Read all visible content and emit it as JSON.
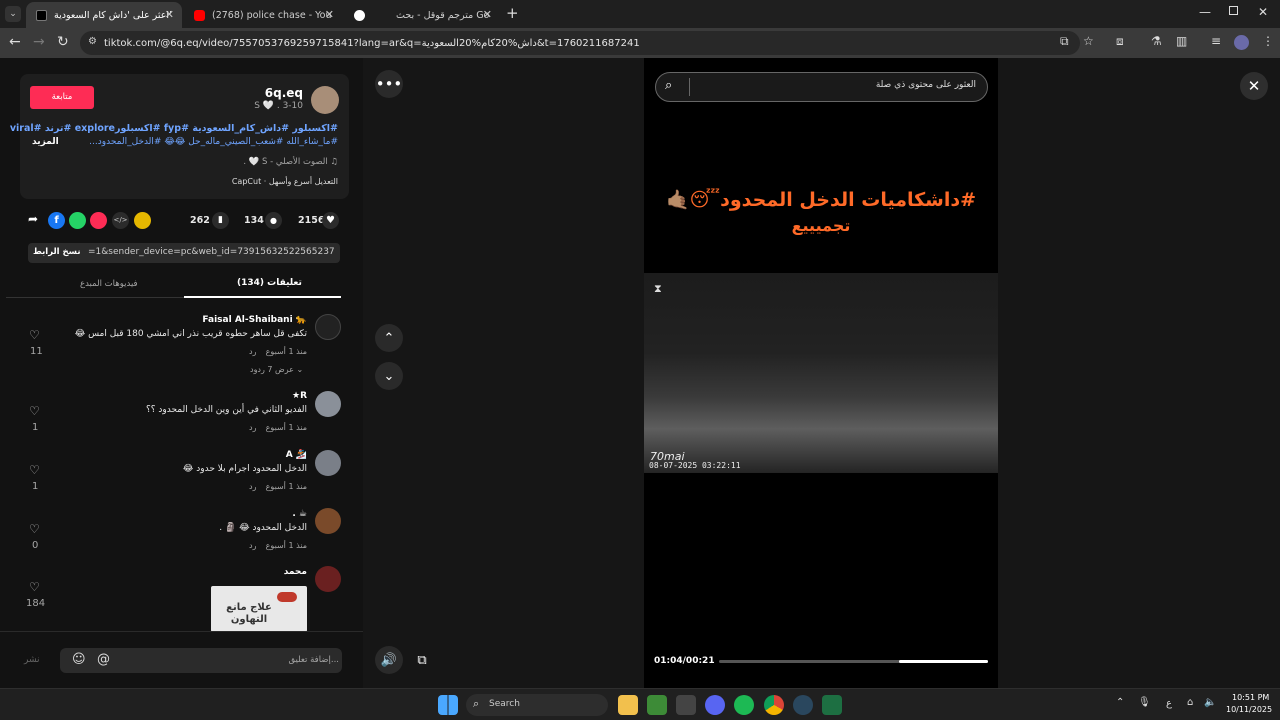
{
  "browser": {
    "tabs": [
      {
        "title": "اعثر على 'داش كام السعودية'",
        "fav_color": "#000000",
        "active": true
      },
      {
        "title": "(2768) police chase - YouTube",
        "fav_color": "#ff0000",
        "active": false
      },
      {
        "title": "مترجم قوقل - بحث Google",
        "fav_color": "#ffffff",
        "active": false
      }
    ],
    "new_tab": "+",
    "url": "tiktok.com/@6q.eq/video/7557053769259715841?lang=ar&q=داش%20كام%20السعودية&t=1760211687241"
  },
  "post": {
    "username": "6q.eq",
    "subline": "S 🤍 . 3-10",
    "follow_label": "متابعة",
    "caption_line1": "#اكسبلور #داش_كام_السعودية #fyp #اكسبلورexplore #ترند #viral",
    "caption_line2": "#ما_شاء_الله #شعب_الصيني_ماله_حل 😂😂 #الدخل_المحدود...",
    "more_label": "المزيد",
    "sound": "♫ الصوت الأصلي - S 🤍 .",
    "capcut_label": "CapCut · التعديل أسرع وأسهل",
    "likes": "2156",
    "comments_count": "134",
    "saves": "262",
    "link_text": "=1&sender_device=pc&web_id=7391563252256523782...",
    "copy_link": "نسخ الرابط"
  },
  "tabs": {
    "comments": "تعليقات (134)",
    "creator_videos": "فيديوهات المبدع"
  },
  "comments": [
    {
      "author": "Faisal Al-Shaibani 🐆",
      "text": "تكفى قل ساهر حطوه قريب نذر اني امشي 180 قبل امس 😂",
      "meta": "منذ 1 أسبوع",
      "reply": "رد",
      "likes": "11",
      "view_replies": "عرض 7 ردود ⌄",
      "avatar_color": "#222222"
    },
    {
      "author": "★R",
      "text": "الفديو الثاني في أين وين الدخل المحدود ؟؟",
      "meta": "منذ 1 أسبوع",
      "reply": "رد",
      "likes": "1",
      "avatar_color": "#8a9099"
    },
    {
      "author": "A 🏂",
      "text": "الدخل المحدود اجرام بلا حدود 😂",
      "meta": "منذ 1 أسبوع",
      "reply": "رد",
      "likes": "1",
      "avatar_color": "#7a7f88"
    },
    {
      "author": ". ☕",
      "text": "الدخل المحدود 😂 🗿 .",
      "meta": "منذ 1 أسبوع",
      "reply": "رد",
      "likes": "0",
      "avatar_color": "#7a4a2a"
    },
    {
      "author": "محمد",
      "text": "",
      "meta": "",
      "reply": "",
      "likes": "184",
      "avatar_color": "#6a2020"
    }
  ],
  "sticker_text": "علاج مانع التهاون",
  "comment_input": {
    "placeholder": "إضافة تعليق...",
    "post": "نشر"
  },
  "video": {
    "search_placeholder": "العثور على محتوى ذي صلة",
    "overlay_line1": "#داشكاميات الدخل المحدود😴🤙🏽",
    "overlay_line2": "تجميييع",
    "cam_brand": "70mai",
    "cam_time": "08-07-2025 03:22:11",
    "time": "01:04/00:21",
    "progress": 0.33
  },
  "taskbar": {
    "search": "Search",
    "lang": "ع",
    "time": "10:51 PM",
    "date": "10/11/2025"
  }
}
